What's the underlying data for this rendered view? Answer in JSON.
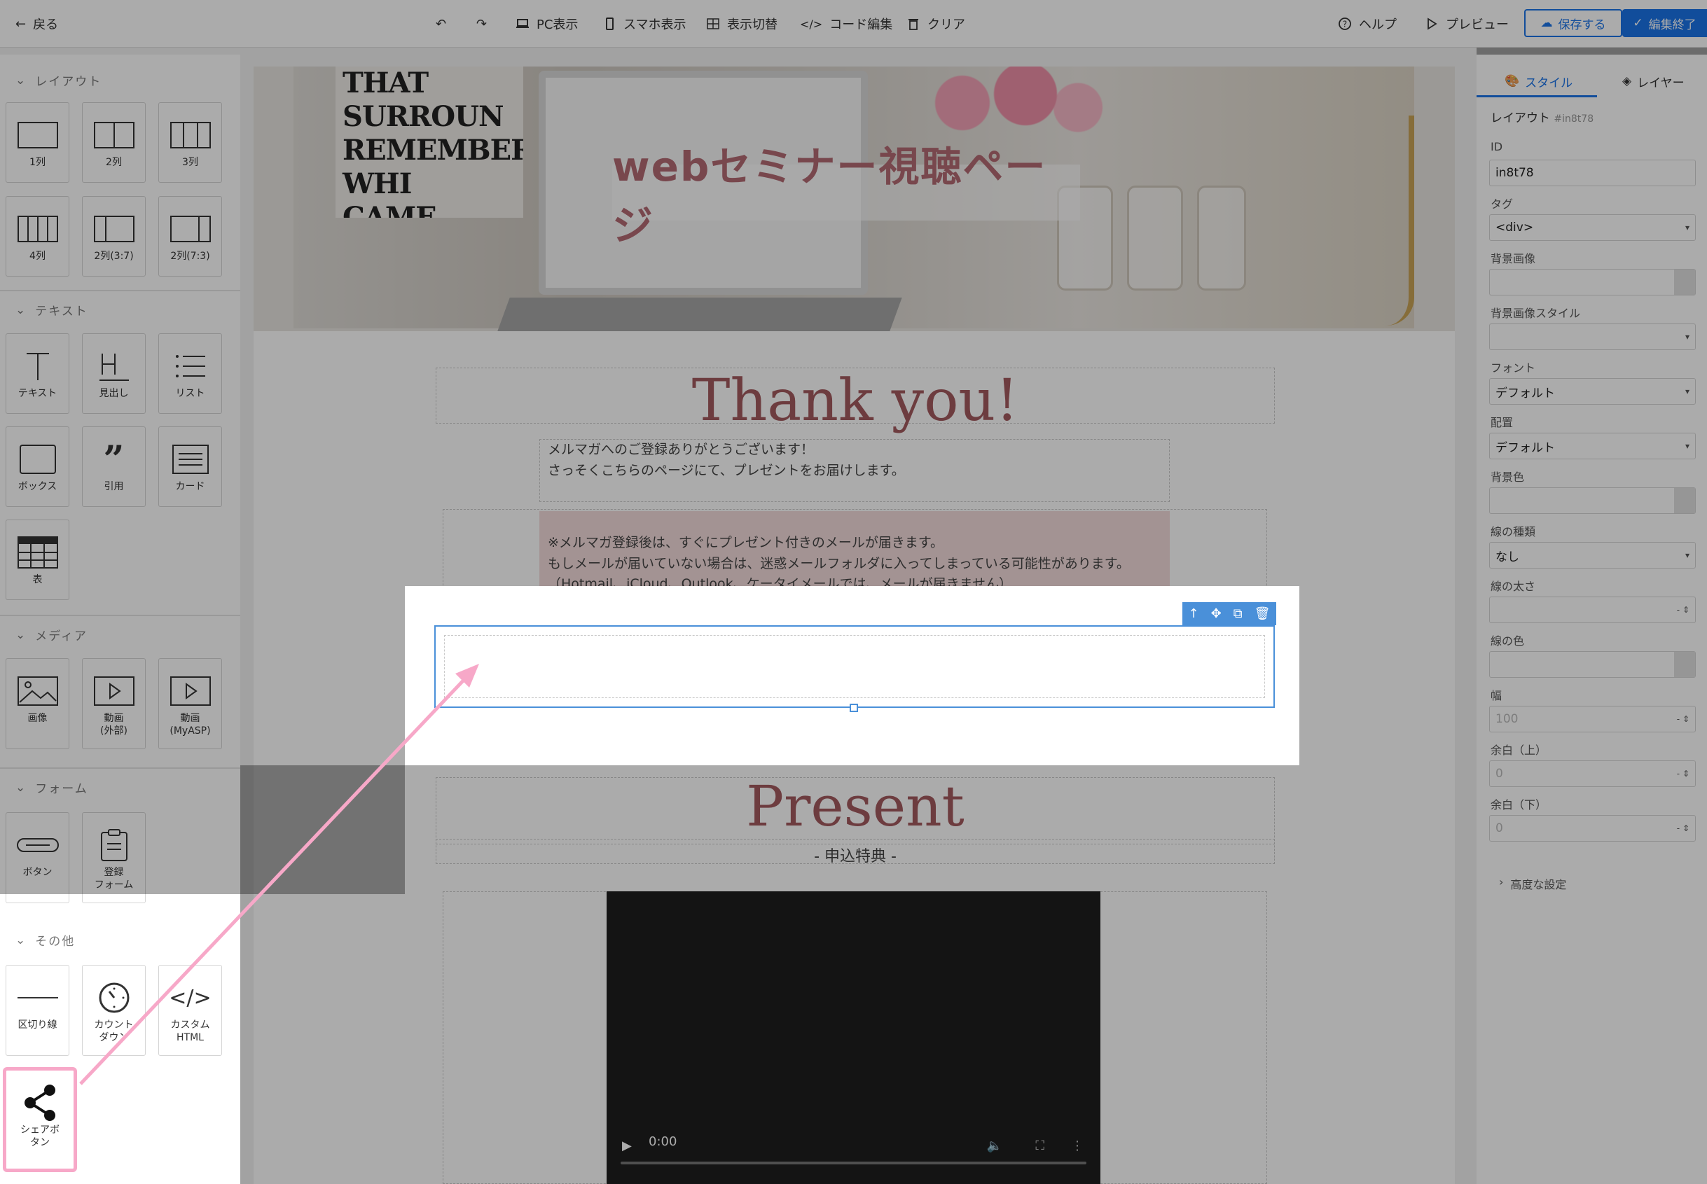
{
  "toolbar": {
    "back": "戻る",
    "pc_view": "PC表示",
    "sp_view": "スマホ表示",
    "toggle_view": "表示切替",
    "code_edit": "コード編集",
    "clear": "クリア",
    "help": "ヘルプ",
    "preview": "プレビュー",
    "save": "保存する",
    "finish": "編集終了"
  },
  "palette": {
    "sections": [
      {
        "title": "レイアウト"
      },
      {
        "title": "テキスト"
      },
      {
        "title": "メディア"
      },
      {
        "title": "フォーム"
      },
      {
        "title": "その他"
      }
    ],
    "layout": [
      "1列",
      "2列",
      "3列",
      "4列",
      "2列(3:7)",
      "2列(7:3)"
    ],
    "text": [
      "テキスト",
      "見出し",
      "リスト",
      "ボックス",
      "引用",
      "カード",
      "表"
    ],
    "media": [
      "画像",
      "動画\n(外部)",
      "動画\n(MyASP)"
    ],
    "form": [
      "ボタン",
      "登録\nフォーム"
    ],
    "other": [
      "区切り線",
      "カウント\nダウン",
      "カスタム\nHTML",
      "シェアボ\nタン"
    ]
  },
  "canvas": {
    "hero_title": "webセミナー視聴ページ",
    "hero_poster": "THAT SURROUN\nREMEMBER WHI\nCAME FROM, BUT\nLOSE SIGHT OF\nYOU ARE GO",
    "thank_you": "Thank you!",
    "message_1": "メルマガへのご登録ありがとうございます！",
    "message_2": "さっそくこちらのページにて、プレゼントをお届けします。",
    "notice_1": "※メルマガ登録後は、すぐにプレゼント付きのメールが届きます。",
    "notice_2": "もしメールが届いていない場合は、迷惑メールフォルダに入ってしまっている可能性があります。",
    "notice_3": "（Hotmail、iCloud、Outlook、ケータイメールでは、メールが届きません）",
    "present": "Present",
    "present_sub": "- 申込特典 -",
    "video_time": "0:00"
  },
  "panel": {
    "tab_style": "スタイル",
    "tab_layer": "レイヤー",
    "element_type": "レイアウト",
    "element_id_hint": "#in8t78",
    "id_label": "ID",
    "id_value": "in8t78",
    "tag_label": "タグ",
    "tag_value": "<div>",
    "bg_image_label": "背景画像",
    "bg_image_style_label": "背景画像スタイル",
    "font_label": "フォント",
    "font_value": "デフォルト",
    "align_label": "配置",
    "align_value": "デフォルト",
    "bg_color_label": "背景色",
    "border_type_label": "線の種類",
    "border_type_value": "なし",
    "border_width_label": "線の太さ",
    "border_width_value": "-",
    "border_color_label": "線の色",
    "width_label": "幅",
    "width_placeholder": "100",
    "width_unit": "-",
    "margin_top_label": "余白（上）",
    "margin_top_placeholder": "0",
    "margin_top_unit": "-",
    "margin_bottom_label": "余白（下）",
    "margin_bottom_placeholder": "0",
    "margin_bottom_unit": "-",
    "advanced": "高度な設定"
  },
  "colors": {
    "accent": "#1a73e8",
    "highlight": "#f7a8c8",
    "heading": "#a35a5e",
    "selection": "#4a90d9"
  }
}
